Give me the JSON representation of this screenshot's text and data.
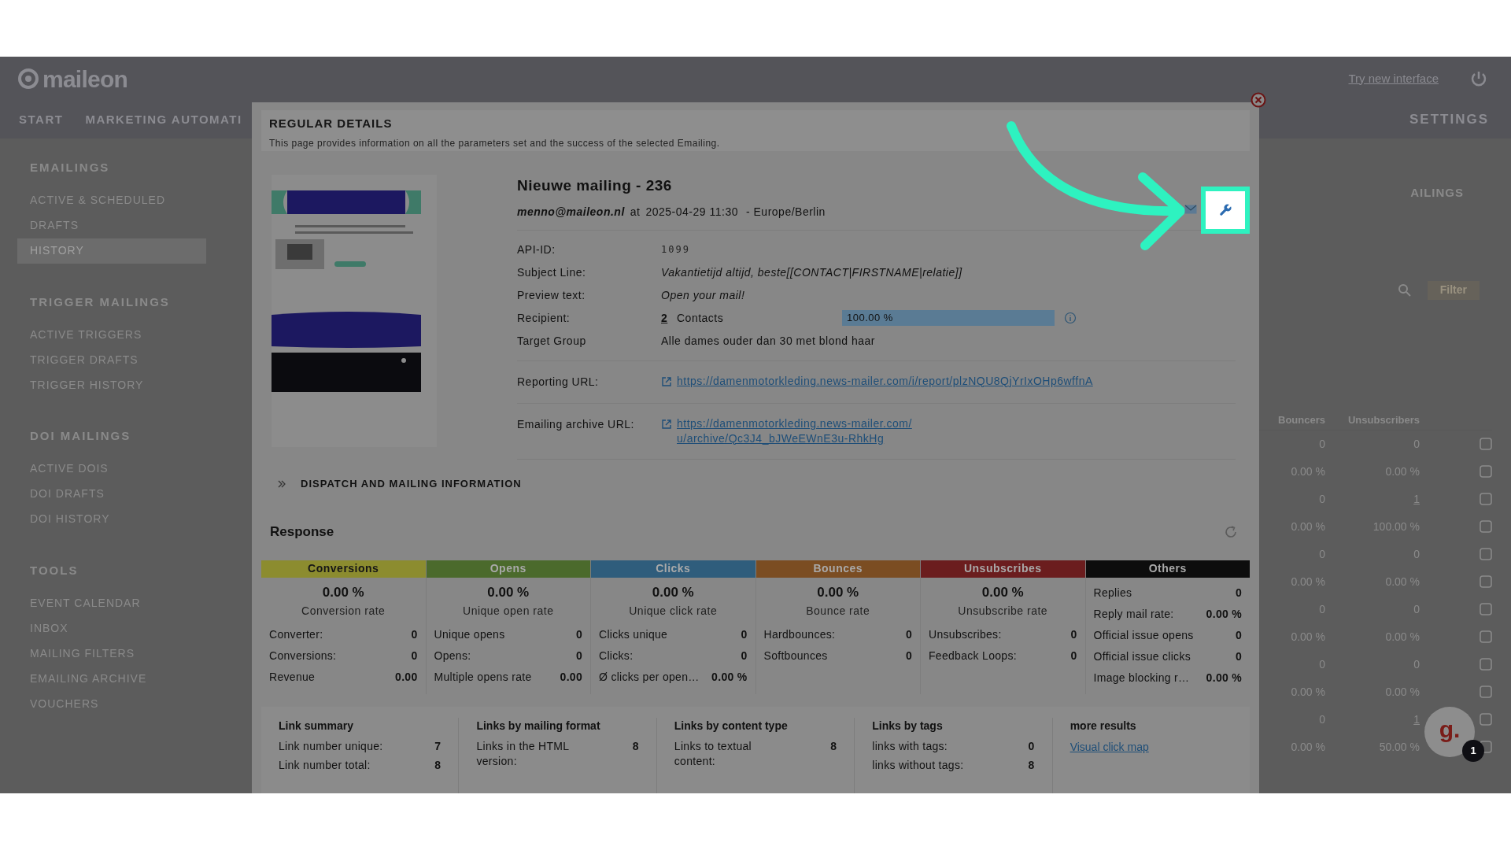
{
  "header": {
    "logo": "maileon",
    "top_links": [
      {
        "label": "Try new interface"
      }
    ],
    "nav": [
      {
        "label": "START"
      },
      {
        "label": "MARKETING AUTOMATI"
      }
    ],
    "nav_right": [
      {
        "label": "SETTINGS"
      }
    ]
  },
  "sidebar": {
    "sections": [
      {
        "title": "EMAILINGS",
        "items": [
          {
            "label": "ACTIVE & SCHEDULED",
            "selected": false
          },
          {
            "label": "DRAFTS",
            "selected": false
          },
          {
            "label": "HISTORY",
            "selected": true
          }
        ]
      },
      {
        "title": "TRIGGER MAILINGS",
        "items": [
          {
            "label": "ACTIVE TRIGGERS",
            "selected": false
          },
          {
            "label": "TRIGGER DRAFTS",
            "selected": false
          },
          {
            "label": "TRIGGER HISTORY",
            "selected": false
          }
        ]
      },
      {
        "title": "DOI MAILINGS",
        "items": [
          {
            "label": "ACTIVE DOIS",
            "selected": false
          },
          {
            "label": "DOI DRAFTS",
            "selected": false
          },
          {
            "label": "DOI HISTORY",
            "selected": false
          }
        ]
      },
      {
        "title": "TOOLS",
        "items": [
          {
            "label": "EVENT CALENDAR",
            "selected": false
          },
          {
            "label": "INBOX",
            "selected": false
          },
          {
            "label": "MAILING FILTERS",
            "selected": false
          },
          {
            "label": "EMAILING ARCHIVE",
            "selected": false
          },
          {
            "label": "VOUCHERS",
            "selected": false
          }
        ]
      }
    ]
  },
  "background_list": {
    "title": "AILINGS",
    "filter_button": "Filter",
    "columns": [
      "Bouncers",
      "Unsubscribers"
    ],
    "rows": [
      {
        "bouncers": "0",
        "unsubscribers": "0",
        "link": false
      },
      {
        "bouncers": "0.00 %",
        "unsubscribers": "0.00 %",
        "link": false
      },
      {
        "bouncers": "0",
        "unsubscribers": "1",
        "link": true
      },
      {
        "bouncers": "0.00 %",
        "unsubscribers": "100.00 %",
        "link": false
      },
      {
        "bouncers": "0",
        "unsubscribers": "0",
        "link": false
      },
      {
        "bouncers": "0.00 %",
        "unsubscribers": "0.00 %",
        "link": false
      },
      {
        "bouncers": "0",
        "unsubscribers": "0",
        "link": false
      },
      {
        "bouncers": "0.00 %",
        "unsubscribers": "0.00 %",
        "link": false
      },
      {
        "bouncers": "0",
        "unsubscribers": "0",
        "link": false
      },
      {
        "bouncers": "0.00 %",
        "unsubscribers": "0.00 %",
        "link": false
      },
      {
        "bouncers": "0",
        "unsubscribers": "1",
        "link": true
      },
      {
        "bouncers": "0.00 %",
        "unsubscribers": "50.00 %",
        "link": false
      }
    ]
  },
  "dialog": {
    "title": "REGULAR DETAILS",
    "description": "This page provides information on all the parameters set and the success of the selected Emailing.",
    "mailing": {
      "name": "Nieuwe mailing - 236",
      "sender": "menno@maileon.nl",
      "at": "at",
      "date": "2025-04-29 11:30",
      "timezone": "- Europe/Berlin"
    },
    "details": [
      {
        "kind": "mono",
        "label": "API-ID:",
        "value": "1099"
      },
      {
        "kind": "italic",
        "label": "Subject Line:",
        "value": "Vakantietijd altijd, beste[[CONTACT|FIRSTNAME|relatie]]"
      },
      {
        "kind": "italic",
        "label": "Preview text:",
        "value": "Open your mail!"
      },
      {
        "kind": "recipient",
        "label": "Recipient:",
        "count": "2",
        "unit": "Contacts",
        "reading": "100.00 %",
        "level": 1
      },
      {
        "kind": "plain",
        "label": "Target Group",
        "value": "Alle dames ouder dan 30 met blond haar"
      }
    ],
    "urls": [
      {
        "label": "Reporting URL:",
        "url": "https://damenmotorkleding.news-mailer.com/i/report/plzNQU8QjYrIxOHp6wffnA"
      },
      {
        "label": "Emailing archive URL:",
        "url": "https://damenmotorkleding.news-mailer.com/u/archive/Qc3J4_bJWeEWnE3u-RhkHg"
      }
    ],
    "dispatch": {
      "label": "DISPATCH AND MAILING INFORMATION",
      "expanded": false
    },
    "response": {
      "title": "Response",
      "groups": [
        {
          "kind": "rate",
          "name": "Conversions",
          "color": "#8c8c2f",
          "rate": "0.00 %",
          "rate_label": "Conversion rate",
          "rows": [
            {
              "label": "Converter:",
              "value": "0"
            },
            {
              "label": "Conversions:",
              "value": "0"
            },
            {
              "label": "Revenue",
              "value": "0.00"
            }
          ]
        },
        {
          "kind": "rate",
          "name": "Opens",
          "color": "#4b6a2c",
          "rate": "0.00 %",
          "rate_label": "Unique open rate",
          "rows": [
            {
              "label": "Unique opens",
              "value": "0"
            },
            {
              "label": "Opens:",
              "value": "0"
            },
            {
              "label": "Multiple opens rate",
              "value": "0.00"
            }
          ]
        },
        {
          "kind": "rate",
          "name": "Clicks",
          "color": "#2f5d7c",
          "rate": "0.00 %",
          "rate_label": "Unique click rate",
          "rows": [
            {
              "label": "Clicks unique",
              "value": "0"
            },
            {
              "label": "Clicks:",
              "value": "0"
            },
            {
              "label": "Ø clicks per open…",
              "value": "0.00 %"
            }
          ]
        },
        {
          "kind": "rate",
          "name": "Bounces",
          "color": "#7b4d22",
          "rate": "0.00 %",
          "rate_label": "Bounce rate",
          "rows": [
            {
              "label": "Hardbounces:",
              "value": "0"
            },
            {
              "label": "Softbounces",
              "value": "0"
            }
          ]
        },
        {
          "kind": "rate",
          "name": "Unsubscribes",
          "color": "#6b1d1e",
          "rate": "0.00 %",
          "rate_label": "Unsubscribe rate",
          "rows": [
            {
              "label": "Unsubscribes:",
              "value": "0"
            },
            {
              "label": "Feedback Loops:",
              "value": "0"
            }
          ]
        },
        {
          "kind": "list",
          "name": "Others",
          "color": "#0d0d0d",
          "rows": [
            {
              "label": "Replies",
              "value": "0"
            },
            {
              "label": "Reply mail rate:",
              "value": "0.00 %"
            },
            {
              "label": "Official issue opens",
              "value": "0"
            },
            {
              "label": "Official issue clicks",
              "value": "0"
            },
            {
              "label": "Image blocking r…",
              "value": "0.00 %"
            }
          ]
        }
      ]
    },
    "links": [
      {
        "kind": "stats",
        "title": "Link summary",
        "rows": [
          {
            "label": "Link number unique:",
            "value": "7"
          },
          {
            "label": "Link number total:",
            "value": "8"
          }
        ]
      },
      {
        "kind": "stats",
        "title": "Links by mailing format",
        "rows": [
          {
            "label": "Links in the HTML version:",
            "value": "8"
          }
        ]
      },
      {
        "kind": "stats",
        "title": "Links by content type",
        "rows": [
          {
            "label": "Links to textual content:",
            "value": "8"
          }
        ]
      },
      {
        "kind": "stats",
        "title": "Links by tags",
        "rows": [
          {
            "label": "links with tags:",
            "value": "0"
          },
          {
            "label": "links without tags:",
            "value": "8"
          }
        ]
      },
      {
        "kind": "link",
        "title": "more results",
        "link": "Visual click map"
      }
    ]
  },
  "chat_widget": {
    "logo": "g.",
    "badge": "1"
  }
}
